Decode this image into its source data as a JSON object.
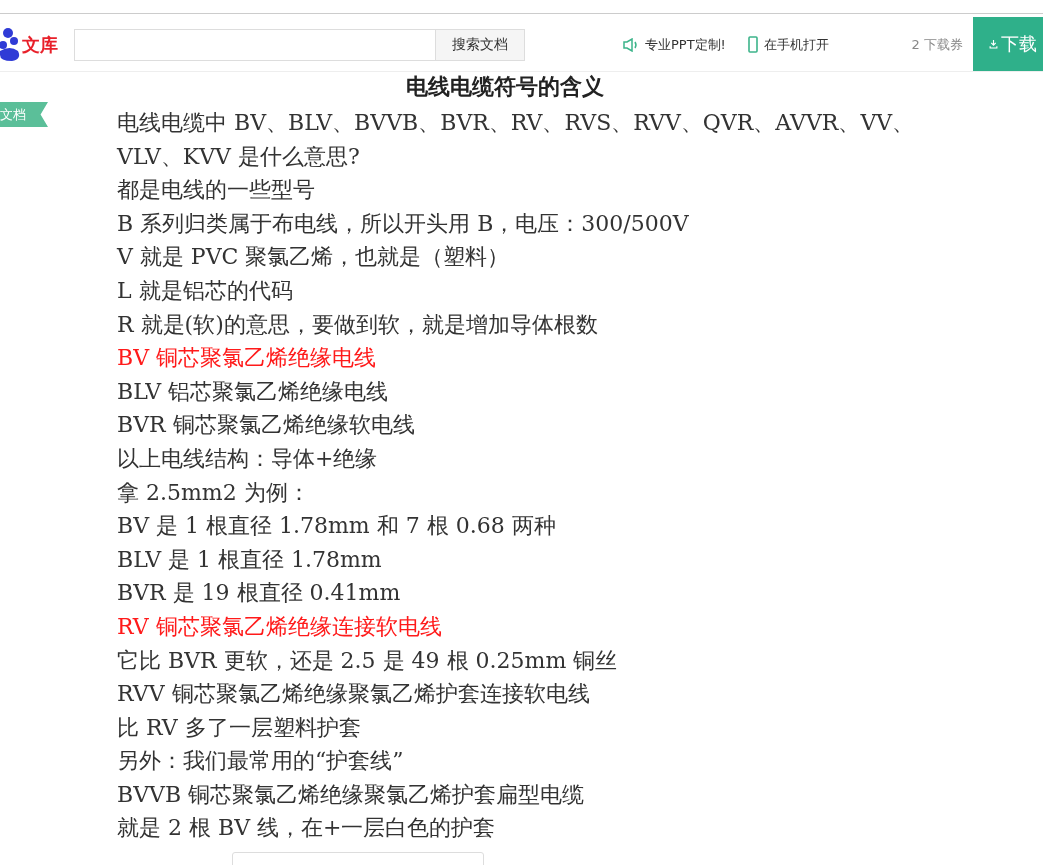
{
  "header": {
    "logo_text": "文库",
    "search": {
      "button": "搜索文档"
    },
    "links": [
      {
        "kind": "speaker",
        "label": "专业PPT定制!"
      },
      {
        "kind": "phone",
        "label": "在手机打开"
      }
    ],
    "coupons": "2 下载券",
    "download_button": "下载"
  },
  "side_ribbon": "文档",
  "title": "电线电缆符号的含义",
  "lines": [
    {
      "text": "电线电缆中 BV、BLV、BVVB、BVR、RV、RVS、RVV、QVR、AVVR、VV、VLV、KVV 是什么意思?",
      "highlight": false
    },
    {
      "text": "都是电线的一些型号",
      "highlight": false
    },
    {
      "text": "B 系列归类属于布电线，所以开头用 B，电压：300/500V",
      "highlight": false
    },
    {
      "text": "V 就是 PVC 聚氯乙烯，也就是（塑料）",
      "highlight": false
    },
    {
      "text": "L 就是铝芯的代码",
      "highlight": false
    },
    {
      "text": "R 就是(软)的意思，要做到软，就是增加导体根数",
      "highlight": false
    },
    {
      "text": "BV 铜芯聚氯乙烯绝缘电线",
      "highlight": true
    },
    {
      "text": "BLV 铝芯聚氯乙烯绝缘电线",
      "highlight": false
    },
    {
      "text": "BVR 铜芯聚氯乙烯绝缘软电线",
      "highlight": false
    },
    {
      "text": "以上电线结构：导体+绝缘",
      "highlight": false
    },
    {
      "text": "拿 2.5mm2 为例：",
      "highlight": false
    },
    {
      "text": "BV 是 1 根直径 1.78mm 和 7 根 0.68 两种",
      "highlight": false
    },
    {
      "text": "BLV 是 1 根直径 1.78mm",
      "highlight": false
    },
    {
      "text": "BVR 是 19 根直径 0.41mm",
      "highlight": false
    },
    {
      "text": "RV 铜芯聚氯乙烯绝缘连接软电线",
      "highlight": true
    },
    {
      "text": "它比 BVR 更软，还是 2.5 是 49 根 0.25mm 铜丝",
      "highlight": false
    },
    {
      "text": "RVV 铜芯聚氯乙烯绝缘聚氯乙烯护套连接软电线",
      "highlight": false
    },
    {
      "text": "比 RV 多了一层塑料护套",
      "highlight": false
    },
    {
      "text": "另外：我们最常用的“护套线”",
      "highlight": false
    },
    {
      "text": "BVVB 铜芯聚氯乙烯绝缘聚氯乙烯护套扁型电缆",
      "highlight": false
    },
    {
      "text": "就是 2 根 BV 线，在+一层白色的护套",
      "highlight": false
    }
  ]
}
